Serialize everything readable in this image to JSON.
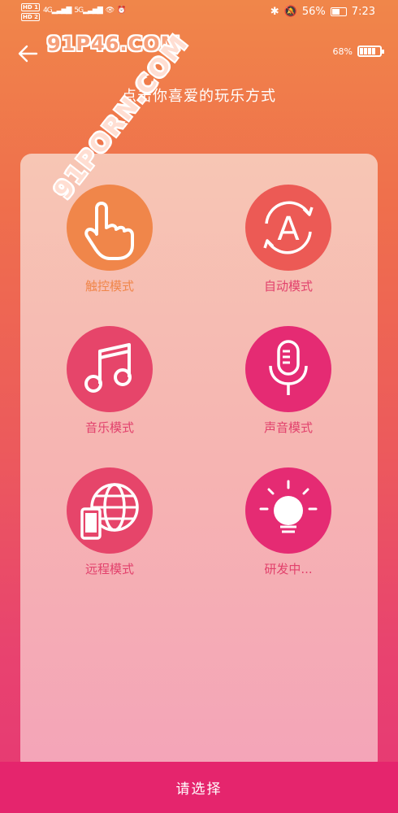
{
  "status_bar": {
    "sim1": "HD 1",
    "sim2": "HD 2",
    "signal1": "4G",
    "signal2": "5G",
    "battery_percent": "56%",
    "time": "7:23"
  },
  "header": {
    "watermark": "91P46.COM",
    "device_battery": "68%",
    "title": "点击你喜爱的玩乐方式"
  },
  "watermark_diag": "91PORN.COM",
  "modes": [
    {
      "label": "触控模式",
      "icon": "hand-touch-icon",
      "color": "#f0864a"
    },
    {
      "label": "自动模式",
      "icon": "auto-mode-icon",
      "color": "#ec5a55"
    },
    {
      "label": "音乐模式",
      "icon": "music-note-icon",
      "color": "#e6456a"
    },
    {
      "label": "声音模式",
      "icon": "microphone-icon",
      "color": "#e52b73"
    },
    {
      "label": "远程模式",
      "icon": "globe-phone-icon",
      "color": "#e6456a"
    },
    {
      "label": "研发中...",
      "icon": "lightbulb-icon",
      "color": "#e52b73"
    }
  ],
  "bottom_button": "请选择"
}
